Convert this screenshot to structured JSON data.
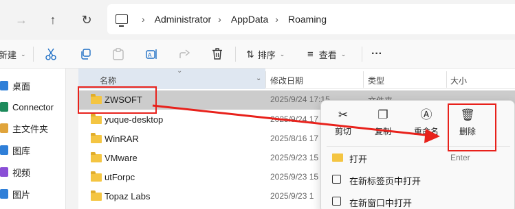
{
  "address": {
    "crumbs": [
      "Administrator",
      "AppData",
      "Roaming"
    ]
  },
  "toolbar": {
    "new_label": "新建",
    "sort_label": "排序",
    "view_label": "查看",
    "more_label": "···"
  },
  "sidebar": {
    "items": [
      {
        "label": "桌面",
        "icon": "desktop-icon",
        "color": "#2f7fd8"
      },
      {
        "label": "Connector",
        "icon": "connector-icon",
        "color": "#1d8a5b"
      },
      {
        "label": "主文件夹",
        "icon": "home-icon",
        "color": "#e0a43b"
      },
      {
        "label": "图库",
        "icon": "gallery-icon",
        "color": "#2f7fd8"
      },
      {
        "label": "视频",
        "icon": "videos-icon",
        "color": "#8a4fd6"
      },
      {
        "label": "图片",
        "icon": "pictures-icon",
        "color": "#2f7fd8"
      }
    ]
  },
  "columns": {
    "name": "名称",
    "date": "修改日期",
    "type": "类型",
    "size": "大小"
  },
  "files": [
    {
      "name": "ZWSOFT",
      "date": "2025/9/24 17:15",
      "type": "文件夹"
    },
    {
      "name": "yuque-desktop",
      "date": "2025/9/24 17",
      "type": ""
    },
    {
      "name": "WinRAR",
      "date": "2025/8/16 17",
      "type": ""
    },
    {
      "name": "VMware",
      "date": "2025/9/23 15",
      "type": ""
    },
    {
      "name": "utForpc",
      "date": "2025/9/23 15",
      "type": ""
    },
    {
      "name": "Topaz Labs",
      "date": "2025/9/23 1",
      "type": ""
    }
  ],
  "context_menu": {
    "cut": "剪切",
    "copy": "复制",
    "rename": "重命名",
    "delete": "删除",
    "items": [
      {
        "label": "打开",
        "shortcut": "Enter"
      },
      {
        "label": "在新标签页中打开",
        "shortcut": ""
      },
      {
        "label": "在新窗口中打开",
        "shortcut": ""
      }
    ]
  },
  "colors": {
    "annotation_red": "#e8211b",
    "selected_row": "#cccccc",
    "folder_yellow": "#f4c542"
  }
}
